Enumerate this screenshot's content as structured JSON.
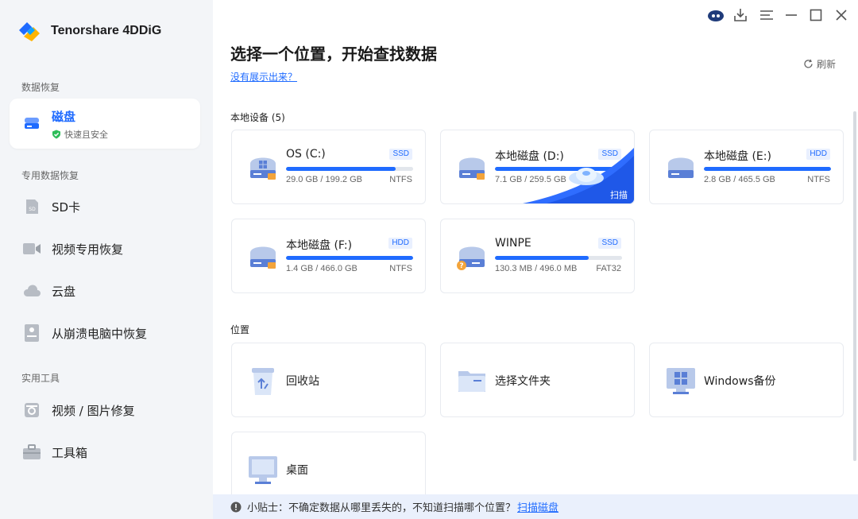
{
  "app": {
    "title": "Tenorshare 4DDiG"
  },
  "sidebar": {
    "section1": "数据恢复",
    "active": {
      "label": "磁盘",
      "sub": "快速且安全"
    },
    "section2": "专用数据恢复",
    "items2": [
      {
        "label": "SD卡",
        "icon": "sd-card-icon"
      },
      {
        "label": "视频专用恢复",
        "icon": "video-icon"
      },
      {
        "label": "云盘",
        "icon": "cloud-icon"
      },
      {
        "label": "从崩溃电脑中恢复",
        "icon": "crashed-pc-icon"
      }
    ],
    "section3": "实用工具",
    "items3": [
      {
        "label": "视频 / 图片修复",
        "icon": "repair-icon"
      },
      {
        "label": "工具箱",
        "icon": "toolbox-icon"
      }
    ]
  },
  "main": {
    "title": "选择一个位置，开始查找数据",
    "help_link": "没有展示出来？",
    "refresh": "刷新",
    "local_devices": "本地设备 (5)",
    "drives": [
      {
        "name": "OS (C:)",
        "type": "SSD",
        "size": "29.0 GB / 199.2 GB",
        "fs": "NTFS",
        "usage": 0.86
      },
      {
        "name": "本地磁盘 (D:)",
        "type": "SSD",
        "size": "7.1 GB / 259.5 GB",
        "fs": "",
        "usage": 0.97,
        "scan": "扫描"
      },
      {
        "name": "本地磁盘 (E:)",
        "type": "HDD",
        "size": "2.8 GB / 465.5 GB",
        "fs": "NTFS",
        "usage": 1.0
      },
      {
        "name": "本地磁盘 (F:)",
        "type": "HDD",
        "size": "1.4 GB / 466.0 GB",
        "fs": "NTFS",
        "usage": 1.0
      },
      {
        "name": "WINPE",
        "type": "SSD",
        "size": "130.3 MB / 496.0 MB",
        "fs": "FAT32",
        "usage": 0.74
      }
    ],
    "locations_title": "位置",
    "locations": [
      {
        "name": "回收站",
        "icon": "recycle-bin-icon"
      },
      {
        "name": "选择文件夹",
        "icon": "folder-icon"
      },
      {
        "name": "Windows备份",
        "icon": "windows-backup-icon"
      },
      {
        "name": "桌面",
        "icon": "desktop-icon"
      }
    ],
    "tip": {
      "text": "小贴士：不确定数据从哪里丢失的，不知道扫描哪个位置？",
      "link": "扫描磁盘"
    }
  },
  "colors": {
    "accent": "#1f6bff",
    "sidebar_bg": "#f3f5f8",
    "tip_bg": "#eaf0fc"
  }
}
